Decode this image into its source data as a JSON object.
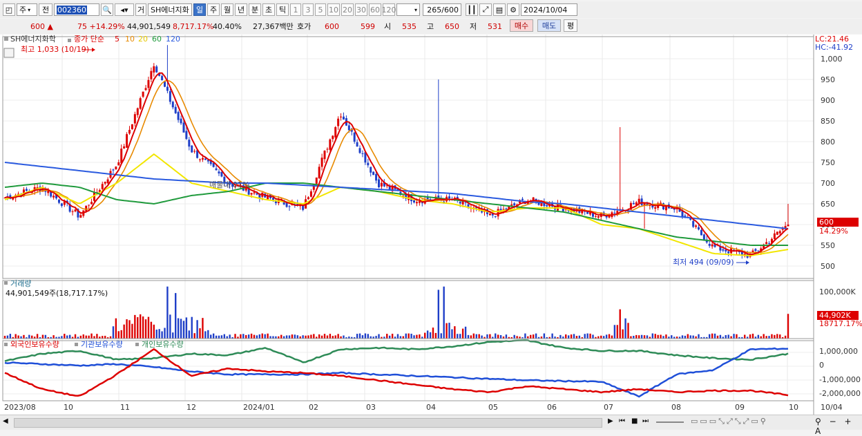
{
  "toolbar": {
    "period_sel": "주",
    "prev_label": "전",
    "code": "002360",
    "market_label": "거",
    "stock_name": "SH에너지화",
    "tabs": [
      "일",
      "주",
      "월",
      "년",
      "분",
      "초",
      "틱"
    ],
    "active_tab": "일",
    "intervals": [
      "1",
      "3",
      "5",
      "10",
      "20",
      "30",
      "60",
      "120"
    ],
    "count": "265",
    "count_total": "/600",
    "date": "2024/10/04"
  },
  "quote": {
    "price": "600",
    "arrow": "▲",
    "change": "75",
    "change_pct": "+14.29%",
    "volume": "44,901,549",
    "vol_ratio": "8,717.17%",
    "rate": "40.40%",
    "amount": "27,367백만",
    "hoga_label": "호가",
    "ask": "600",
    "bid": "599",
    "open_label": "시",
    "open": "535",
    "high_label": "고",
    "high": "650",
    "low_label": "저",
    "low": "531",
    "buy": "매수",
    "sell": "매도",
    "eval": "평"
  },
  "price_panel": {
    "name": "SH에너지화학",
    "ma_label": "종가 단순",
    "ma_periods": [
      "5",
      "10",
      "20",
      "60",
      "120"
    ],
    "ma_colors": [
      "#dd0000",
      "#e88a00",
      "#f2e600",
      "#1f9a3c",
      "#2a5adf"
    ],
    "lc": "LC:21.46",
    "hc": "HC:-41.92",
    "max_note": "최고 1,033 (10/19)",
    "min_note": "최저 494 (09/09)",
    "mid_note": "매물대 01%",
    "cur_price": "600",
    "cur_pct": "14.29%",
    "y_ticks": [
      "1,000",
      "950",
      "900",
      "850",
      "800",
      "750",
      "700",
      "650",
      "600",
      "550",
      "500"
    ]
  },
  "volume_panel": {
    "title": "거래량",
    "value": "44,901,549주(18,717.17%)",
    "tick": "100,000K",
    "cur": "44,902K",
    "cur_pct": "18717.17%"
  },
  "holding_panel": {
    "legend": [
      "외국인보유수량",
      "기관보유수량",
      "개인보유수량"
    ],
    "colors": [
      "#dd0000",
      "#1f4fd8",
      "#2e8b57"
    ],
    "y_ticks": [
      "1,000,000",
      "0",
      "-1,000,000",
      "-2,000,000"
    ]
  },
  "x_axis": {
    "labels": [
      "2023/08",
      "10",
      "11",
      "12",
      "2024/01",
      "02",
      "03",
      "04",
      "05",
      "06",
      "07",
      "08",
      "09",
      "10"
    ],
    "right_label": "10/04"
  },
  "chart_data": {
    "type": "line",
    "title": "SH에너지화학",
    "x_range": [
      "2023/08",
      "2024/10/04"
    ],
    "ylim": [
      470,
      1040
    ],
    "series": [
      {
        "name": "종가",
        "values": [
          665,
          690,
          620,
          745,
          990,
          780,
          700,
          665,
          640,
          870,
          700,
          660,
          660,
          620,
          660,
          640,
          620,
          655,
          640,
          545,
          525,
          600
        ]
      },
      {
        "name": "20",
        "values": [
          660,
          690,
          650,
          700,
          770,
          700,
          680,
          660,
          650,
          690,
          680,
          660,
          650,
          630,
          640,
          640,
          600,
          590,
          560,
          530,
          525,
          540
        ]
      },
      {
        "name": "60",
        "values": [
          690,
          700,
          690,
          660,
          650,
          670,
          680,
          700,
          700,
          690,
          680,
          670,
          660,
          650,
          640,
          630,
          610,
          590,
          570,
          560,
          550,
          550
        ]
      },
      {
        "name": "120",
        "values": [
          750,
          740,
          730,
          720,
          710,
          705,
          700,
          700,
          695,
          690,
          685,
          680,
          675,
          665,
          655,
          650,
          640,
          630,
          620,
          610,
          600,
          590
        ]
      }
    ],
    "annotations": [
      "최고 1,033 (10/19)",
      "최저 494 (09/09)"
    ],
    "volume": {
      "title": "거래량",
      "last": "44,902K"
    },
    "holdings": {
      "legend": [
        "외국인보유수량",
        "기관보유수량",
        "개인보유수량"
      ],
      "ylim": [
        -2300000,
        1400000
      ]
    }
  }
}
